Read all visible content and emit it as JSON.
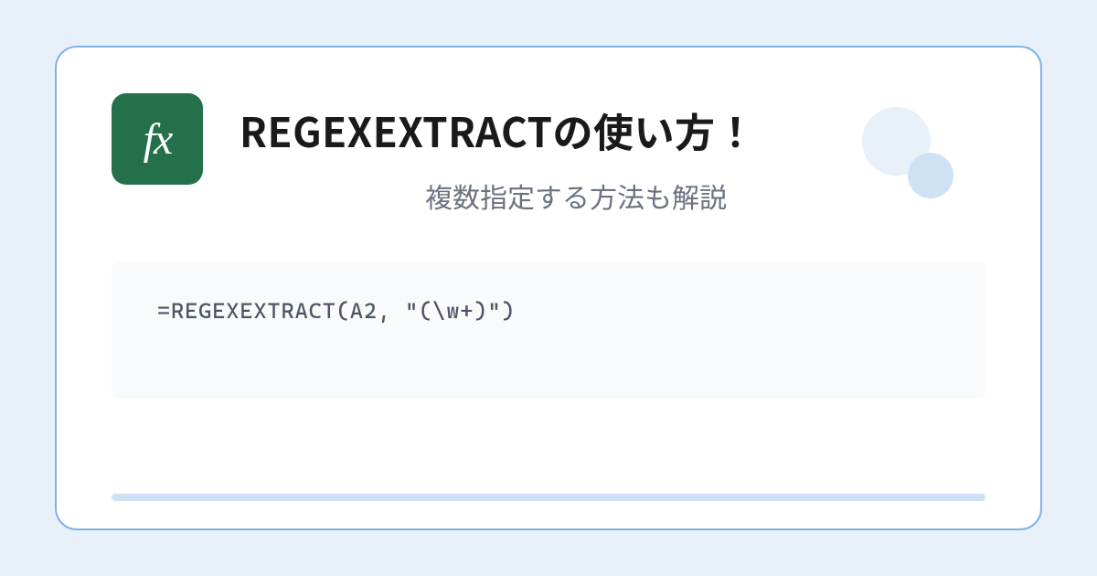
{
  "icon": {
    "label": "fx"
  },
  "header": {
    "title": "REGEXEXTRACTの使い方！",
    "subtitle": "複数指定する方法も解説"
  },
  "code": {
    "formula": "=REGEXEXTRACT(A2, \"(\\w+)\")"
  }
}
